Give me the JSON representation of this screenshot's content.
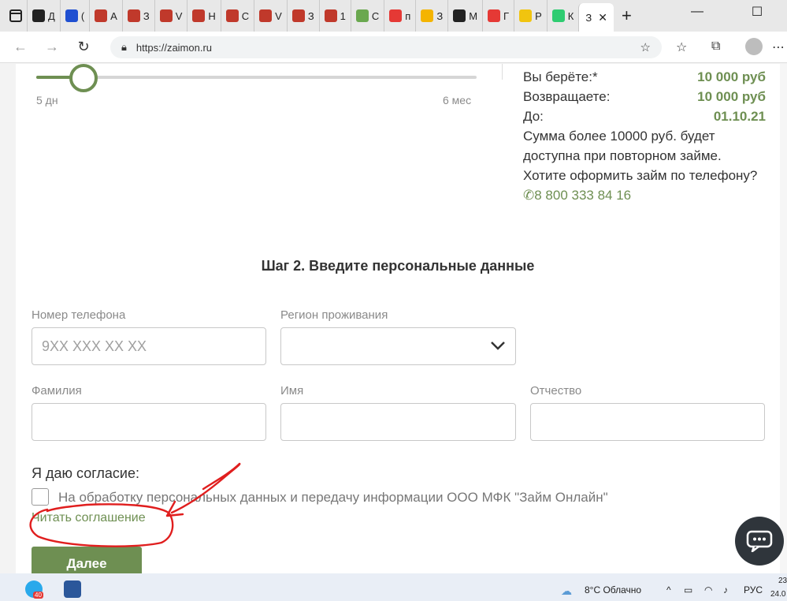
{
  "browser": {
    "tabs": [
      {
        "label": "Д",
        "favicon": "#222"
      },
      {
        "label": "(",
        "favicon": "#1f4fd1"
      },
      {
        "label": "А",
        "favicon": "#c0392b"
      },
      {
        "label": "З",
        "favicon": "#c0392b"
      },
      {
        "label": "V",
        "favicon": "#c0392b"
      },
      {
        "label": "Н",
        "favicon": "#c0392b"
      },
      {
        "label": "С",
        "favicon": "#c0392b"
      },
      {
        "label": "V",
        "favicon": "#c0392b"
      },
      {
        "label": "З",
        "favicon": "#c0392b"
      },
      {
        "label": "1",
        "favicon": "#c0392b"
      },
      {
        "label": "С",
        "favicon": "#6aa84f"
      },
      {
        "label": "п",
        "favicon": "#e53935"
      },
      {
        "label": "З",
        "favicon": "#f4b400"
      },
      {
        "label": "М",
        "favicon": "#222"
      },
      {
        "label": "Г",
        "favicon": "#e53935"
      },
      {
        "label": "Р",
        "favicon": "#f1c40f"
      },
      {
        "label": "К",
        "favicon": "#2ecc71"
      }
    ],
    "active_tab": {
      "label": "З",
      "close": "✕"
    },
    "new_tab": "+",
    "url": "https://zaimon.ru"
  },
  "slider": {
    "min_label": "5 дн",
    "max_label": "6 мес",
    "value_fraction": 0.1
  },
  "summary": {
    "take_label": "Вы берёте:*",
    "take_value": "10 000 руб",
    "return_label": "Возвращаете:",
    "return_value": "10 000 руб",
    "until_label": "До:",
    "until_value": "01.10.21",
    "note": "Сумма более 10000 руб. будет доступна при повторном займе. Хотите оформить займ по телефону?",
    "phone": "✆8 800 333 84 16"
  },
  "form": {
    "step_title": "Шаг 2. Введите персональные данные",
    "phone_label": "Номер телефона",
    "phone_placeholder": "9XX XXX XX XX",
    "region_label": "Регион проживания",
    "lastname_label": "Фамилия",
    "firstname_label": "Имя",
    "middlename_label": "Отчество",
    "consent_title": "Я даю согласие:",
    "consent_text": "На обработку персональных данных и передачу информации ООО МФК \"Займ Онлайн\"",
    "read_link": "Читать соглашение",
    "next_button": "Далее"
  },
  "taskbar": {
    "badge": "40",
    "weather": "8°C  Облачно",
    "lang": "РУС",
    "time": "23",
    "date": "24.0"
  },
  "colors": {
    "accent": "#6e8f52",
    "annotation": "#e01e1e"
  }
}
